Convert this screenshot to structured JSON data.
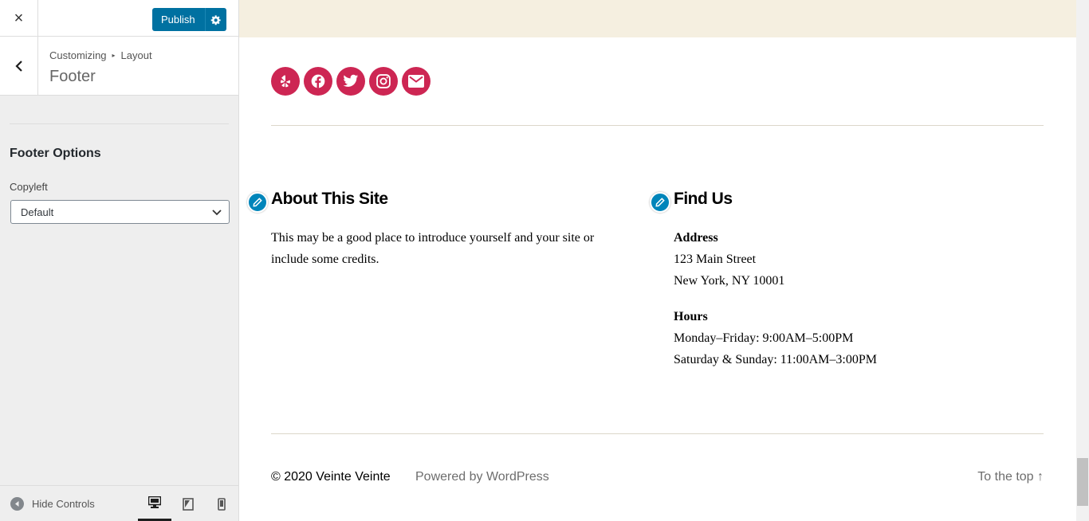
{
  "sidebar": {
    "close_icon": "×",
    "publish_label": "Publish",
    "breadcrumb_root": "Customizing",
    "breadcrumb_sep": "▸",
    "breadcrumb_parent": "Layout",
    "section_title": "Footer",
    "options_title": "Footer Options",
    "copyleft_label": "Copyleft",
    "copyleft_value": "Default",
    "hide_controls_label": "Hide Controls"
  },
  "preview": {
    "social_icons": [
      "yelp-icon",
      "facebook-icon",
      "twitter-icon",
      "instagram-icon",
      "mail-icon"
    ],
    "about": {
      "title": "About This Site",
      "line1": "This may be a good place to introduce yourself and your site or",
      "line2": "include some credits."
    },
    "find_us": {
      "title": "Find Us",
      "address_label": "Address",
      "address_line1": "123 Main Street",
      "address_line2": "New York, NY 10001",
      "hours_label": "Hours",
      "hours_line1": "Monday–Friday: 9:00AM–5:00PM",
      "hours_line2": "Saturday & Sunday: 11:00AM–3:00PM"
    },
    "footer": {
      "copyright": "© 2020 Veinte Veinte",
      "powered": "Powered by WordPress",
      "to_top": "To the top ↑"
    }
  },
  "colors": {
    "accent": "#cd2653",
    "publish": "#0071a1",
    "edit_shortcut": "#0085ba",
    "header_strip": "#f5efe0"
  }
}
